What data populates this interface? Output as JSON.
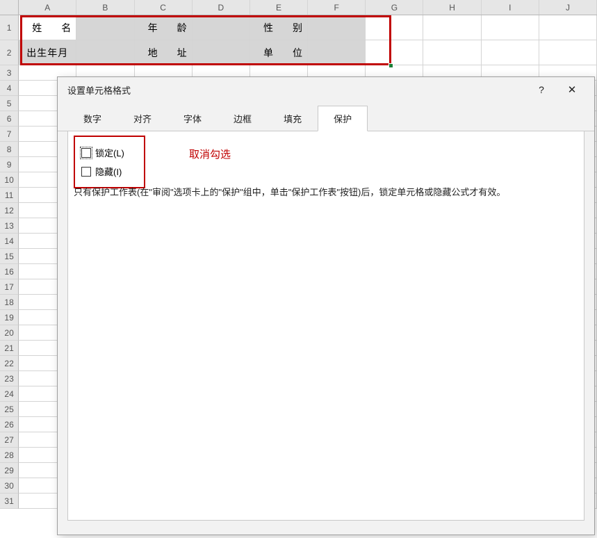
{
  "columns": [
    "A",
    "B",
    "C",
    "D",
    "E",
    "F",
    "G",
    "H",
    "I",
    "J"
  ],
  "row_numbers": [
    "1",
    "2",
    "3",
    "4",
    "5",
    "6",
    "7",
    "8",
    "9",
    "10",
    "11",
    "12",
    "13",
    "14",
    "15",
    "16",
    "17",
    "18",
    "19",
    "20",
    "21",
    "22",
    "23",
    "24",
    "25",
    "26",
    "27",
    "28",
    "29",
    "30",
    "31"
  ],
  "grid": {
    "r1": {
      "c1": "姓　　名",
      "c2": "",
      "c3": "年　　龄",
      "c4": "",
      "c5": "性　　别",
      "c6": ""
    },
    "r2": {
      "c1": "出生年月",
      "c2": "",
      "c3": "地　　址",
      "c4": "",
      "c5": "单　　位",
      "c6": ""
    }
  },
  "dialog": {
    "title": "设置单元格格式",
    "help": "?",
    "close": "✕",
    "tabs": [
      "数字",
      "对齐",
      "字体",
      "边框",
      "填充",
      "保护"
    ],
    "active_tab_index": 5,
    "protection": {
      "lock_label": "锁定(L)",
      "hidden_label": "隐藏(I)",
      "lock_checked": false,
      "hidden_checked": false,
      "annotation": "取消勾选",
      "info": "只有保护工作表(在\"审阅\"选项卡上的\"保护\"组中，单击\"保护工作表\"按钮)后，锁定单元格或隐藏公式才有效。"
    }
  }
}
